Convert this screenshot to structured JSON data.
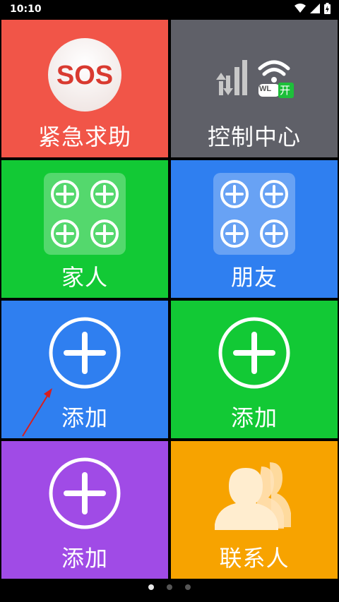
{
  "status_bar": {
    "time": "10:10"
  },
  "tiles": [
    {
      "label": "紧急求助",
      "color": "#f15548",
      "icon": "sos-icon",
      "icon_text": "SOS"
    },
    {
      "label": "控制中心",
      "color": "#5f6068",
      "icon": "signal-wifi-icon",
      "wifi_badge": "WL",
      "wifi_state": "开"
    },
    {
      "label": "家人",
      "color": "#12c935",
      "icon": "add-grid-icon"
    },
    {
      "label": "朋友",
      "color": "#2f7ff0",
      "icon": "add-grid-icon"
    },
    {
      "label": "添加",
      "color": "#2f7ff0",
      "icon": "add-circle-icon"
    },
    {
      "label": "添加",
      "color": "#12c935",
      "icon": "add-circle-icon"
    },
    {
      "label": "添加",
      "color": "#a04be6",
      "icon": "add-circle-icon"
    },
    {
      "label": "联系人",
      "color": "#f7a300",
      "icon": "contacts-icon"
    }
  ],
  "pager": {
    "pages": 3,
    "active": 0
  }
}
